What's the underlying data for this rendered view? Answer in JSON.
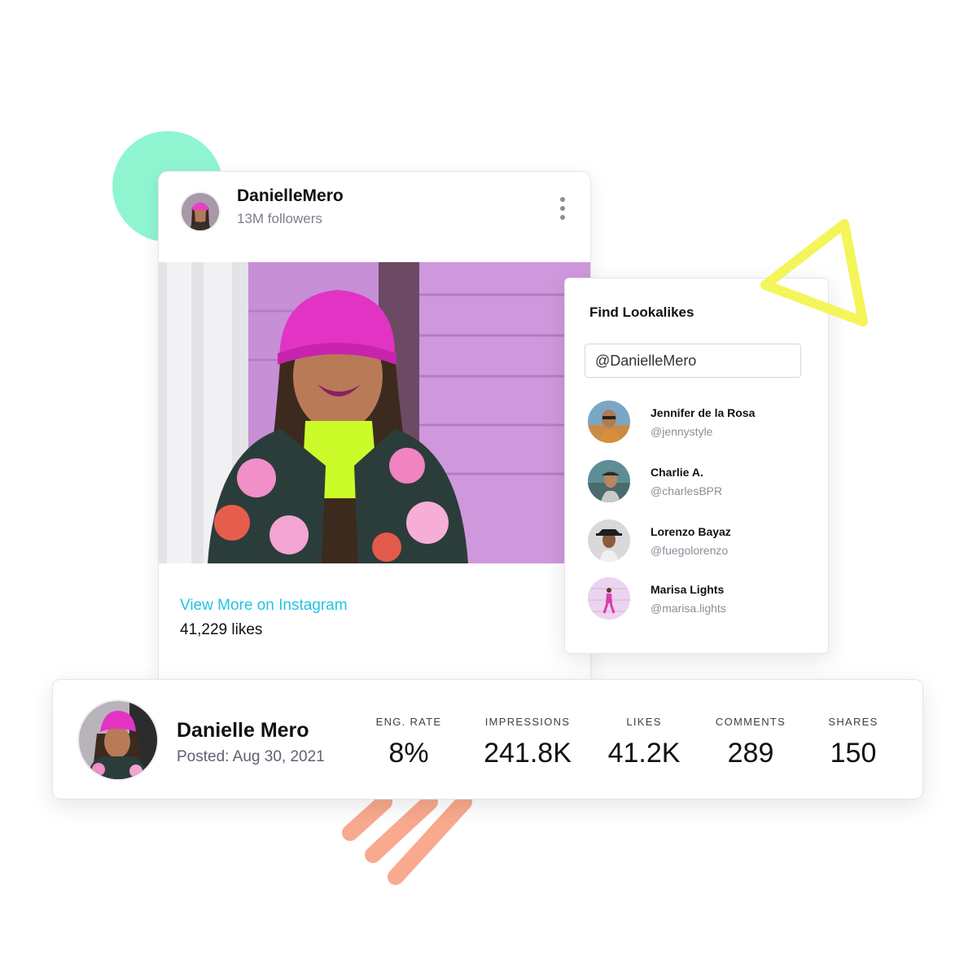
{
  "post": {
    "username": "DanielleMero",
    "followers": "13M followers",
    "link_label": "View More on Instagram",
    "likes": "41,229 likes"
  },
  "lookalikes": {
    "title": "Find Lookalikes",
    "search_value": "@DanielleMero",
    "items": [
      {
        "name": "Jennifer de la Rosa",
        "handle": "@jennystyle"
      },
      {
        "name": "Charlie A.",
        "handle": "@charlesBPR"
      },
      {
        "name": "Lorenzo Bayaz",
        "handle": "@fuegolorenzo"
      },
      {
        "name": "Marisa Lights",
        "handle": "@marisa.lights"
      }
    ]
  },
  "stats": {
    "name": "Danielle Mero",
    "posted": "Posted: Aug 30, 2021",
    "metrics": [
      {
        "label": "ENG. RATE",
        "value": "8%"
      },
      {
        "label": "IMPRESSIONS",
        "value": "241.8K"
      },
      {
        "label": "LIKES",
        "value": "41.2K"
      },
      {
        "label": "COMMENTS",
        "value": "289"
      },
      {
        "label": "SHARES",
        "value": "150"
      }
    ]
  },
  "icons": {
    "more": "vertical-ellipsis-icon"
  },
  "colors": {
    "accent_link": "#22c3e6",
    "deco_circle": "#8ff5d0",
    "deco_triangle": "#f3f558",
    "deco_lines": "#f8a98e"
  }
}
